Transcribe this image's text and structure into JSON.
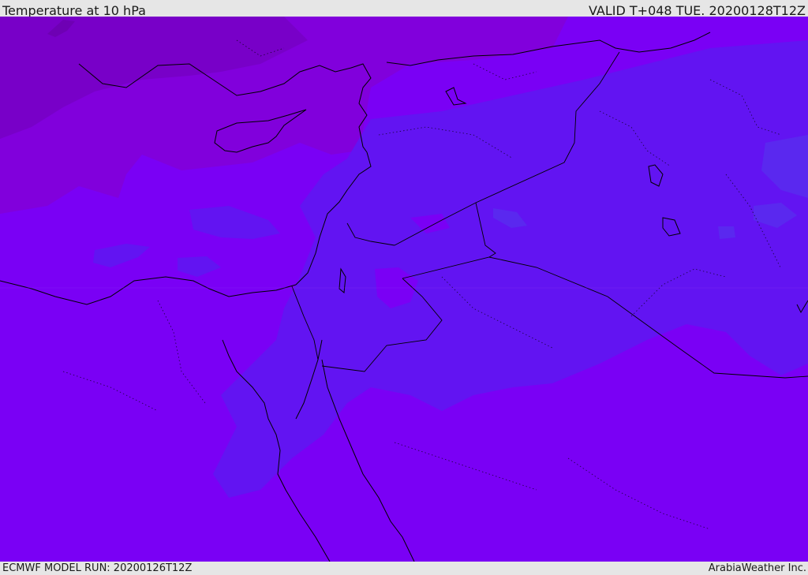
{
  "header": {
    "title": "Temperature at 10 hPa",
    "valid": "VALID T+048 TUE. 20200128T12Z"
  },
  "footer": {
    "model_run": "ECMWF MODEL RUN: 20200126T12Z",
    "credit": "ArabiaWeather Inc."
  },
  "colors": {
    "field_base": "#7a00f5",
    "field_warm": "#8100dc",
    "field_warmer": "#7800c8",
    "field_cold": "#6214f2",
    "field_colder": "#5a28ef",
    "coast": "#000000",
    "border": "#000000"
  }
}
